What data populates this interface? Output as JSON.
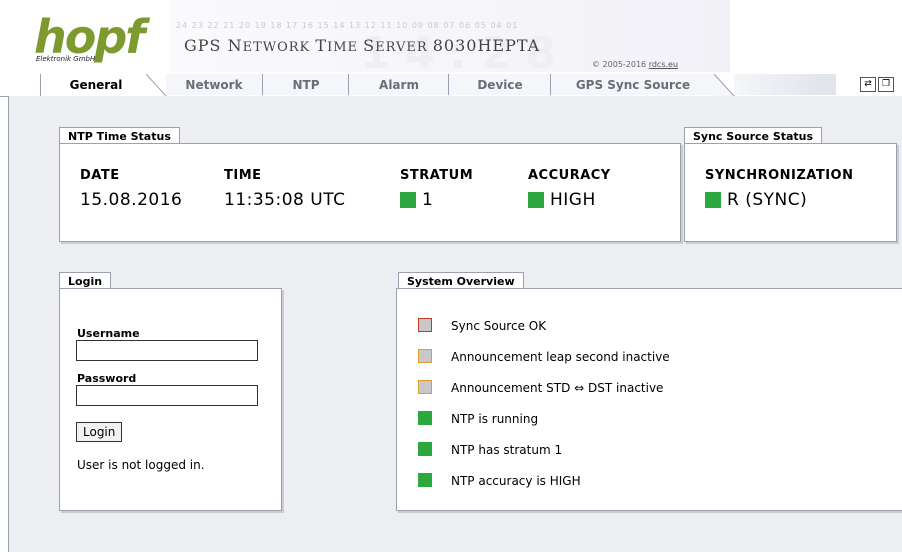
{
  "header": {
    "logo": "hopf",
    "logo_sub": "Elektronik  GmbH",
    "digits": "24 23 22 21 20 19 18 17 16 15 14 13 12 11 10 09 08 07 06 05 04 01",
    "title": "GPS Network Time Server 8030HEPTA",
    "copyright_prefix": "© 2005-2016 ",
    "copyright_link": "rdcs.eu"
  },
  "tabs": [
    "General",
    "Network",
    "NTP",
    "Alarm",
    "Device",
    "GPS Sync Source"
  ],
  "active_tab": "General",
  "ntp_status": {
    "tab": "NTP Time Status",
    "date_label": "DATE",
    "date_value": "15.08.2016",
    "time_label": "TIME",
    "time_value": "11:35:08 UTC",
    "stratum_label": "STRATUM",
    "stratum_value": "1",
    "accuracy_label": "ACCURACY",
    "accuracy_value": "HIGH"
  },
  "sync_status": {
    "tab": "Sync Source Status",
    "label": "SYNCHRONIZATION",
    "value": "R (SYNC)"
  },
  "login": {
    "tab": "Login",
    "username_label": "Username",
    "username_value": "",
    "password_label": "Password",
    "password_value": "",
    "button": "Login",
    "status": "User is not logged in."
  },
  "overview": {
    "tab": "System Overview",
    "items": [
      {
        "text": "Sync Source OK",
        "status": "red"
      },
      {
        "text": "Announcement leap second inactive",
        "status": "orange"
      },
      {
        "text": "Announcement STD ⇔ DST inactive",
        "status": "orange"
      },
      {
        "text": "NTP is running",
        "status": "green"
      },
      {
        "text": "NTP has stratum 1",
        "status": "green"
      },
      {
        "text": "NTP accuracy is HIGH",
        "status": "green"
      }
    ]
  },
  "colors": {
    "ok_green": "#2ca83e",
    "logo_green": "#7e9a2e",
    "border": "#9aa0ac"
  }
}
